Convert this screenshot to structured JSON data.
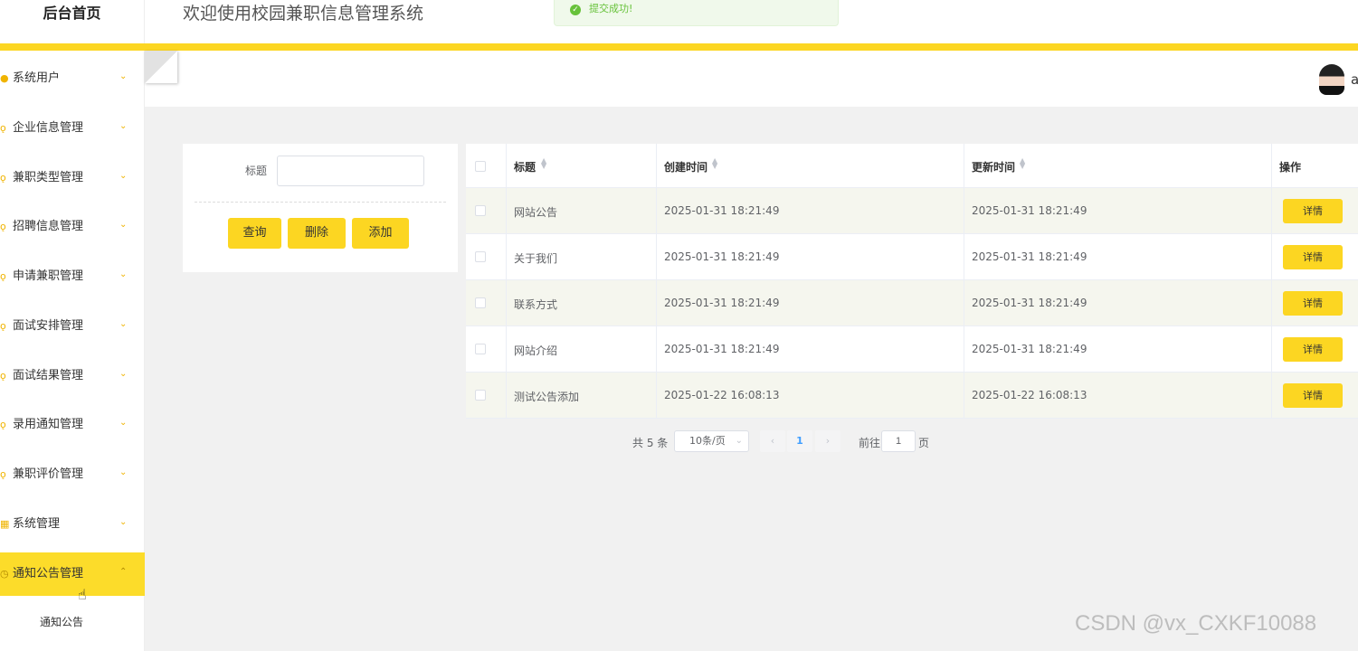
{
  "header": {
    "brand": "后台首页",
    "system_title": "欢迎使用校园兼职信息管理系统",
    "username": "a"
  },
  "toast": {
    "message": "提交成功!",
    "color": "#67c23a"
  },
  "theme": {
    "accent": "#fcd622",
    "accent_text": "#333333"
  },
  "sidebar": {
    "items": [
      {
        "label": "系统用户",
        "icon": "user-icon"
      },
      {
        "label": "企业信息管理",
        "icon": "bulb-icon"
      },
      {
        "label": "兼职类型管理",
        "icon": "bulb-icon"
      },
      {
        "label": "招聘信息管理",
        "icon": "bulb-icon"
      },
      {
        "label": "申请兼职管理",
        "icon": "bulb-icon"
      },
      {
        "label": "面试安排管理",
        "icon": "bulb-icon"
      },
      {
        "label": "面试结果管理",
        "icon": "bulb-icon"
      },
      {
        "label": "录用通知管理",
        "icon": "bulb-icon"
      },
      {
        "label": "兼职评价管理",
        "icon": "bulb-icon"
      },
      {
        "label": "系统管理",
        "icon": "grid-icon"
      },
      {
        "label": "通知公告管理",
        "icon": "clock-icon",
        "active": true
      }
    ],
    "sub_items": [
      {
        "label": "通知公告"
      }
    ]
  },
  "search": {
    "title_label": "标题",
    "title_value": "",
    "query_label": "查询",
    "delete_label": "删除",
    "add_label": "添加"
  },
  "table": {
    "columns": [
      "标题",
      "创建时间",
      "更新时间",
      "操作"
    ],
    "rows": [
      {
        "title": "网站公告",
        "created": "2025-01-31 18:21:49",
        "updated": "2025-01-31 18:21:49",
        "action": "详情"
      },
      {
        "title": "关于我们",
        "created": "2025-01-31 18:21:49",
        "updated": "2025-01-31 18:21:49",
        "action": "详情"
      },
      {
        "title": "联系方式",
        "created": "2025-01-31 18:21:49",
        "updated": "2025-01-31 18:21:49",
        "action": "详情"
      },
      {
        "title": "网站介绍",
        "created": "2025-01-31 18:21:49",
        "updated": "2025-01-31 18:21:49",
        "action": "详情"
      },
      {
        "title": "测试公告添加",
        "created": "2025-01-22 16:08:13",
        "updated": "2025-01-22 16:08:13",
        "action": "详情"
      }
    ]
  },
  "pagination": {
    "total_text": "共 5 条",
    "page_size": "10条/页",
    "current_page": "1",
    "goto_label": "前往",
    "goto_value": "1",
    "page_suffix": "页"
  },
  "watermark": "CSDN @vx_CXKF10088"
}
